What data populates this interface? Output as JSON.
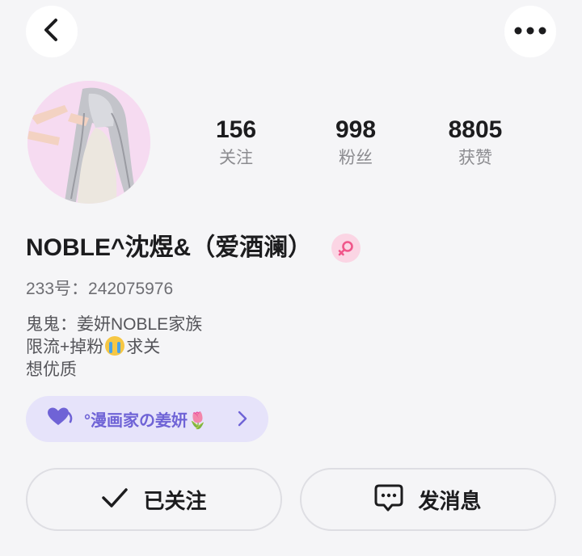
{
  "stats": [
    {
      "value": "156",
      "label": "关注"
    },
    {
      "value": "998",
      "label": "粉丝"
    },
    {
      "value": "8805",
      "label": "获赞"
    }
  ],
  "profile": {
    "username": "NOBLE^沈煜&（爱酒澜）",
    "gender": "female",
    "uid_label": "233号：",
    "uid_value": "242075976",
    "bio_lines": [
      "鬼鬼：姜妍NOBLE家族",
      "限流+掉粉",
      "求关",
      "想优质"
    ]
  },
  "club": {
    "name": "°漫画家の姜妍🌷",
    "icon": "heart-icon"
  },
  "actions": {
    "followed_label": "已关注",
    "message_label": "发消息"
  },
  "colors": {
    "background": "#f5f5f7",
    "accent_purple": "#6f63d6",
    "chip_bg": "#e6e3fa",
    "gender_pink": "#fbd5e4"
  }
}
